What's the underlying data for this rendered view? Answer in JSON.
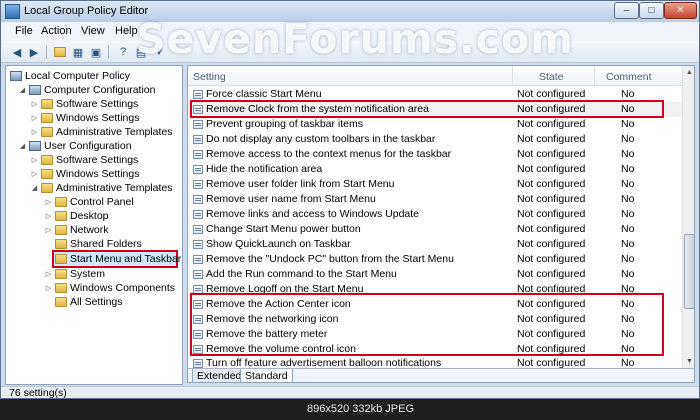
{
  "window": {
    "title": "Local Group Policy Editor"
  },
  "watermark": "SevenForums.com",
  "menu": {
    "items": [
      "File",
      "Action",
      "View",
      "Help"
    ]
  },
  "toolbar": {
    "icons": [
      "back-arrow-icon",
      "forward-arrow-icon",
      "folder-up-icon",
      "show-hide-tree-icon",
      "export-list-icon",
      "help-icon",
      "properties-icon",
      "filter-icon"
    ]
  },
  "tree": {
    "nodes": [
      {
        "label": "Local Computer Policy",
        "icon": "computer-policy-icon"
      },
      {
        "label": "Computer Configuration",
        "icon": "computer-icon"
      },
      {
        "label": "Software Settings",
        "icon": "folder-icon"
      },
      {
        "label": "Windows Settings",
        "icon": "folder-icon"
      },
      {
        "label": "Administrative Templates",
        "icon": "folder-icon"
      },
      {
        "label": "User Configuration",
        "icon": "user-icon"
      },
      {
        "label": "Software Settings",
        "icon": "folder-icon"
      },
      {
        "label": "Windows Settings",
        "icon": "folder-icon"
      },
      {
        "label": "Administrative Templates",
        "icon": "folder-icon"
      },
      {
        "label": "Control Panel",
        "icon": "folder-icon"
      },
      {
        "label": "Desktop",
        "icon": "folder-icon"
      },
      {
        "label": "Network",
        "icon": "folder-icon"
      },
      {
        "label": "Shared Folders",
        "icon": "folder-icon"
      },
      {
        "label": "Start Menu and Taskbar",
        "icon": "folder-icon",
        "selected": true
      },
      {
        "label": "System",
        "icon": "folder-icon"
      },
      {
        "label": "Windows Components",
        "icon": "folder-icon"
      },
      {
        "label": "All Settings",
        "icon": "settings-icon"
      }
    ]
  },
  "list": {
    "headers": {
      "setting": "Setting",
      "state": "State",
      "comment": "Comment"
    },
    "rows": [
      {
        "name": "Force classic Start Menu",
        "state": "Not configured",
        "comment": "No"
      },
      {
        "name": "Remove Clock from the system notification area",
        "state": "Not configured",
        "comment": "No",
        "highlighted": true
      },
      {
        "name": "Prevent grouping of taskbar items",
        "state": "Not configured",
        "comment": "No"
      },
      {
        "name": "Do not display any custom toolbars in the taskbar",
        "state": "Not configured",
        "comment": "No"
      },
      {
        "name": "Remove access to the context menus for the taskbar",
        "state": "Not configured",
        "comment": "No"
      },
      {
        "name": "Hide the notification area",
        "state": "Not configured",
        "comment": "No"
      },
      {
        "name": "Remove user folder link from Start Menu",
        "state": "Not configured",
        "comment": "No"
      },
      {
        "name": "Remove user name from Start Menu",
        "state": "Not configured",
        "comment": "No"
      },
      {
        "name": "Remove links and access to Windows Update",
        "state": "Not configured",
        "comment": "No"
      },
      {
        "name": "Change Start Menu power button",
        "state": "Not configured",
        "comment": "No"
      },
      {
        "name": "Show QuickLaunch on Taskbar",
        "state": "Not configured",
        "comment": "No"
      },
      {
        "name": "Remove the \"Undock PC\" button from the Start Menu",
        "state": "Not configured",
        "comment": "No"
      },
      {
        "name": "Add the Run command to the Start Menu",
        "state": "Not configured",
        "comment": "No"
      },
      {
        "name": "Remove Logoff on the Start Menu",
        "state": "Not configured",
        "comment": "No"
      },
      {
        "name": "Remove the Action Center icon",
        "state": "Not configured",
        "comment": "No"
      },
      {
        "name": "Remove the networking icon",
        "state": "Not configured",
        "comment": "No"
      },
      {
        "name": "Remove the battery meter",
        "state": "Not configured",
        "comment": "No"
      },
      {
        "name": "Remove the volume control icon",
        "state": "Not configured",
        "comment": "No"
      },
      {
        "name": "Turn off feature advertisement balloon notifications",
        "state": "Not configured",
        "comment": "No"
      }
    ]
  },
  "tabs": [
    {
      "label": "Extended"
    },
    {
      "label": "Standard"
    }
  ],
  "status": {
    "text": "76 setting(s)"
  },
  "image_info": "896x520  332kb  JPEG",
  "colors": {
    "annotation": "#d0021b",
    "selection": "#cde8ff"
  }
}
